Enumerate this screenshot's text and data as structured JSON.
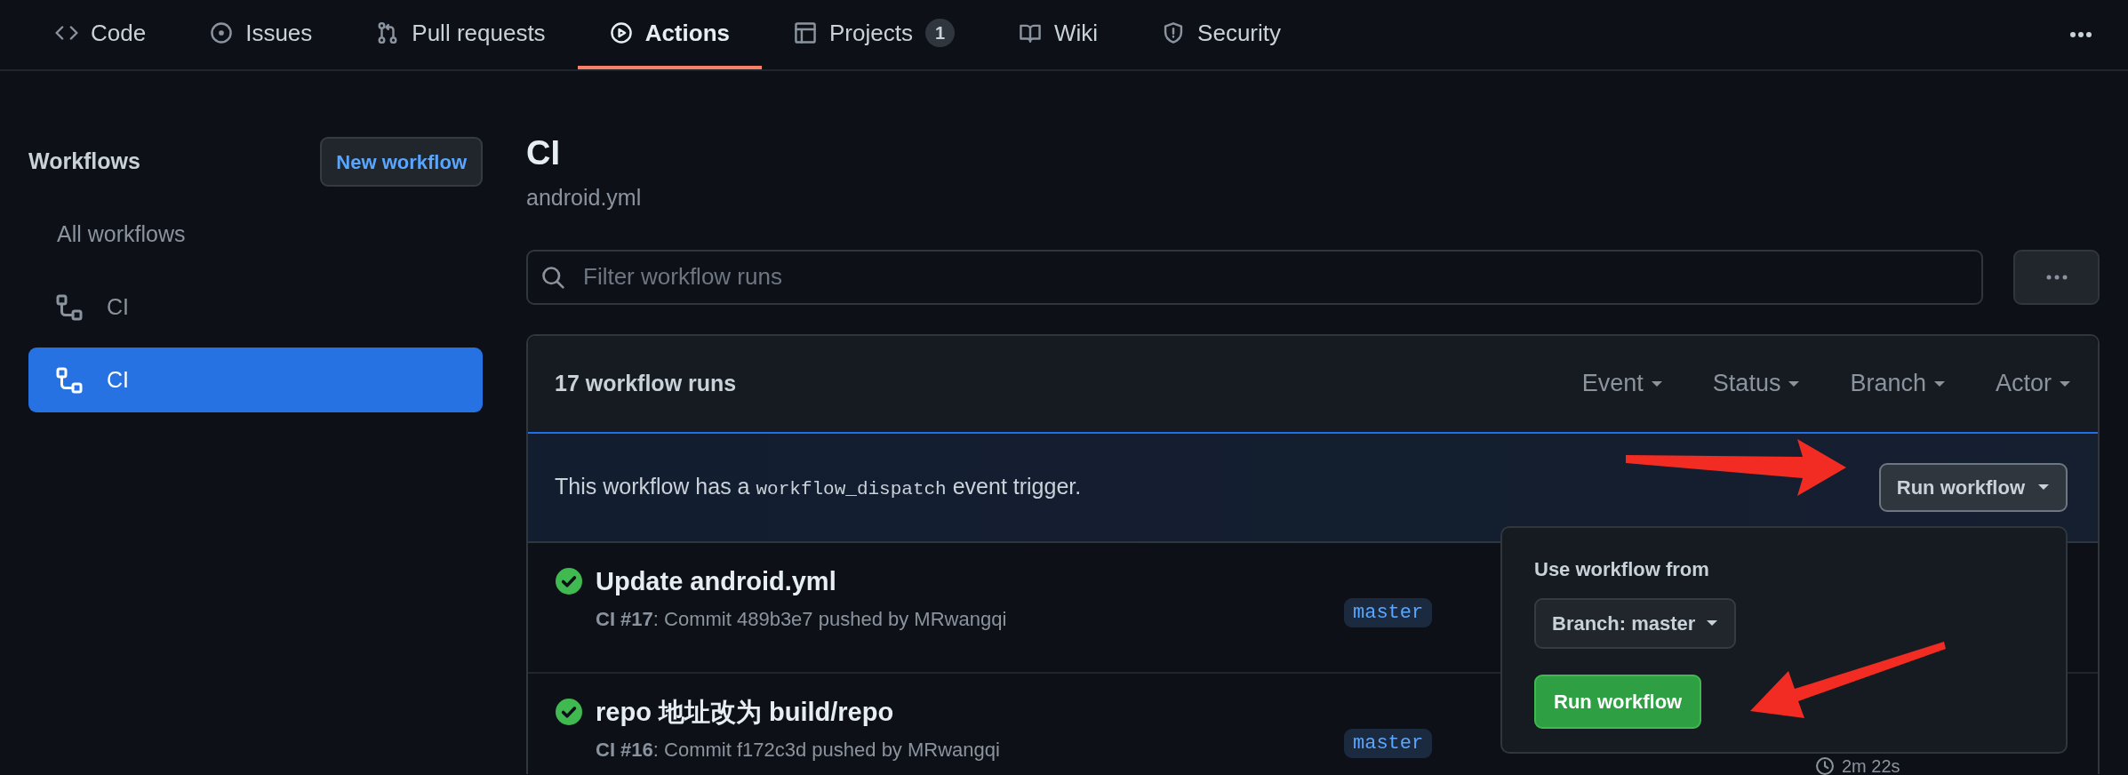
{
  "nav": {
    "tabs": [
      {
        "label": "Code",
        "selected": false
      },
      {
        "label": "Issues",
        "selected": false
      },
      {
        "label": "Pull requests",
        "selected": false
      },
      {
        "label": "Actions",
        "selected": true
      },
      {
        "label": "Projects",
        "selected": false,
        "counter": "1"
      },
      {
        "label": "Wiki",
        "selected": false
      },
      {
        "label": "Security",
        "selected": false
      }
    ]
  },
  "sidebar": {
    "title": "Workflows",
    "new_button": "New workflow",
    "items": [
      {
        "label": "All workflows",
        "kind": "all",
        "selected": false
      },
      {
        "label": "CI",
        "kind": "workflow",
        "selected": false
      },
      {
        "label": "CI",
        "kind": "workflow",
        "selected": true
      }
    ]
  },
  "main": {
    "title": "CI",
    "file": "android.yml",
    "filter": {
      "placeholder": "Filter workflow runs"
    },
    "runs_count": "17 workflow runs",
    "filters": [
      "Event",
      "Status",
      "Branch",
      "Actor"
    ],
    "banner": {
      "before": "This workflow has a ",
      "code": "workflow_dispatch",
      "after": " event trigger.",
      "button": "Run workflow"
    },
    "popover": {
      "heading": "Use workflow from",
      "branch_button": "Branch: master",
      "run_button": "Run workflow"
    },
    "runs": [
      {
        "title": "Update android.yml",
        "meta": "**CI #17**: Commit 489b3e7 pushed by MRwangqi",
        "branch": "master"
      },
      {
        "title": "repo 地址改为 build/repo",
        "meta": "**CI #16**: Commit f172c3d pushed by MRwangqi",
        "branch": "master",
        "duration": "2m 22s"
      }
    ]
  }
}
